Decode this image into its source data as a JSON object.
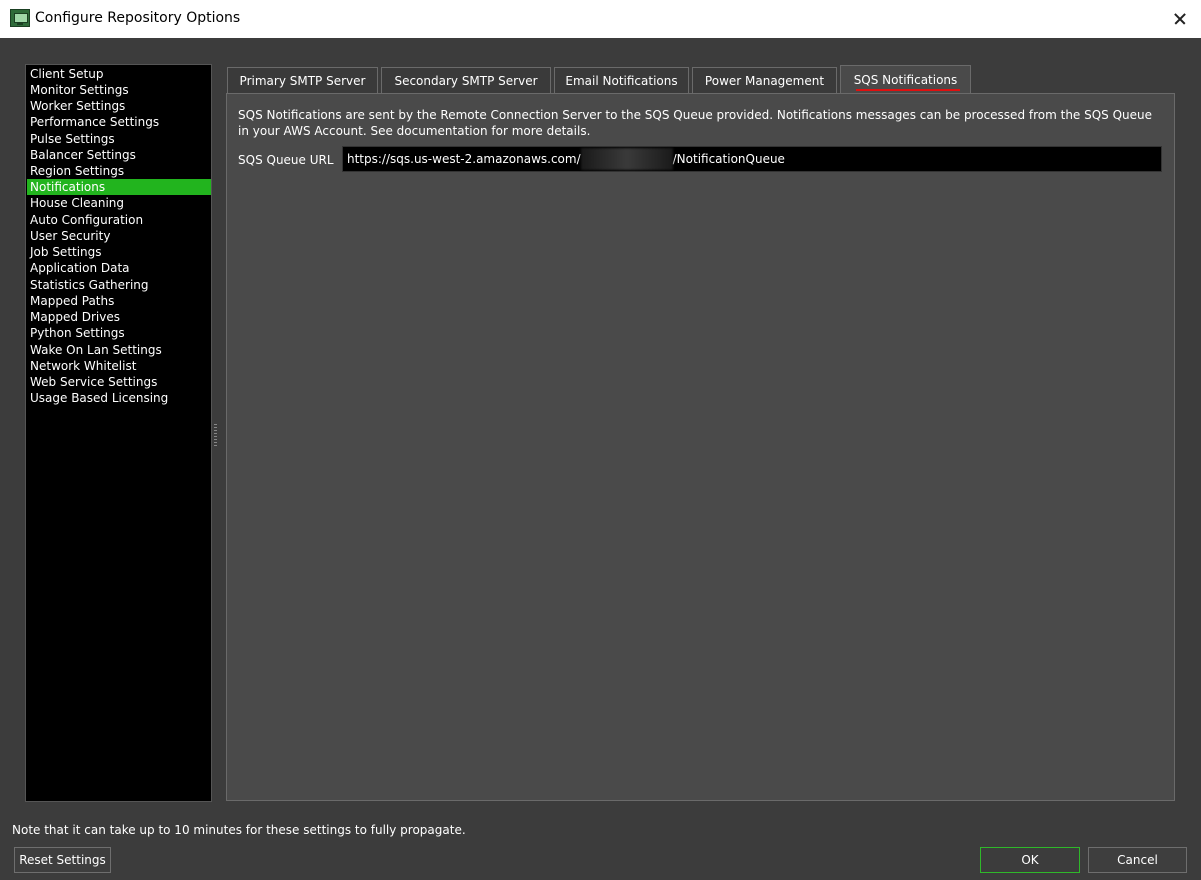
{
  "window": {
    "title": "Configure Repository Options",
    "app_icon": "monitor-icon",
    "close_icon": "close-icon"
  },
  "sidebar": {
    "items": [
      {
        "label": "Client Setup"
      },
      {
        "label": "Monitor Settings"
      },
      {
        "label": "Worker Settings"
      },
      {
        "label": "Performance Settings"
      },
      {
        "label": "Pulse Settings"
      },
      {
        "label": "Balancer Settings"
      },
      {
        "label": "Region Settings"
      },
      {
        "label": "Notifications",
        "selected": true
      },
      {
        "label": "House Cleaning"
      },
      {
        "label": "Auto Configuration"
      },
      {
        "label": "User Security"
      },
      {
        "label": "Job Settings"
      },
      {
        "label": "Application Data"
      },
      {
        "label": "Statistics Gathering"
      },
      {
        "label": "Mapped Paths"
      },
      {
        "label": "Mapped Drives"
      },
      {
        "label": "Python Settings"
      },
      {
        "label": "Wake On Lan Settings"
      },
      {
        "label": "Network Whitelist"
      },
      {
        "label": "Web Service Settings"
      },
      {
        "label": "Usage Based Licensing"
      }
    ]
  },
  "tabs": [
    {
      "label": "Primary SMTP Server"
    },
    {
      "label": "Secondary SMTP Server"
    },
    {
      "label": "Email Notifications"
    },
    {
      "label": "Power Management"
    },
    {
      "label": "SQS Notifications",
      "active": true
    }
  ],
  "sqs": {
    "description": "SQS Notifications are sent by the Remote Connection Server to the SQS Queue provided. Notifications messages can be processed from the SQS Queue in your AWS Account. See documentation for more details.",
    "url_label": "SQS Queue URL",
    "url_prefix": "https://sqs.us-west-2.amazonaws.com/",
    "url_suffix": "/NotificationQueue"
  },
  "footer": {
    "note": "Note that it can take up to 10 minutes for these settings to fully propagate.",
    "reset_label": "Reset Settings",
    "ok_label": "OK",
    "cancel_label": "Cancel"
  },
  "colors": {
    "selected_item": "#22b41e",
    "active_tab_underline": "#e01010",
    "ok_border": "#2fb82a"
  }
}
